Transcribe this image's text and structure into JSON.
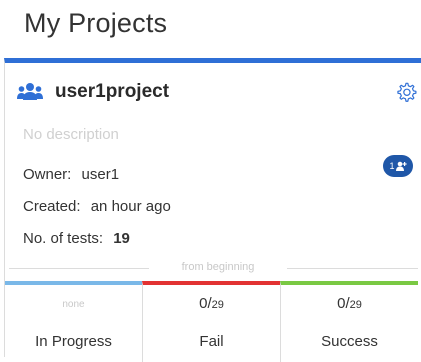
{
  "page": {
    "title": "My Projects"
  },
  "card": {
    "accent_color": "#2f6fd6",
    "project_name": "user1project",
    "description": "No description",
    "owner_label": "Owner:",
    "owner_value": "user1",
    "created_label": "Created:",
    "created_value": "an hour ago",
    "tests_label": "No. of tests:",
    "tests_value": "19",
    "share_badge_text": "1",
    "divider_label": "from beginning",
    "icons": {
      "project": "group-icon",
      "settings": "gear-icon",
      "share": "add-user-icon"
    }
  },
  "stats": [
    {
      "value": "none",
      "denominator": "",
      "label": "In Progress",
      "color": "#7ab8e8"
    },
    {
      "value": "0/",
      "denominator": "29",
      "label": "Fail",
      "color": "#e23232"
    },
    {
      "value": "0/",
      "denominator": "29",
      "label": "Success",
      "color": "#7ac943"
    }
  ]
}
